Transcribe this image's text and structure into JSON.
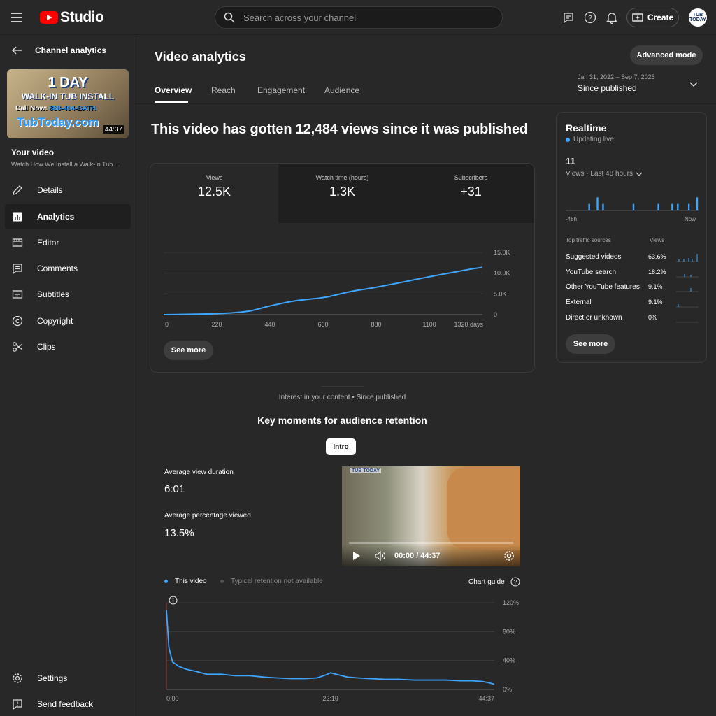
{
  "header": {
    "logo_text": "Studio",
    "search_placeholder": "Search across your channel",
    "create_label": "Create",
    "avatar_text": "TUB TODAY"
  },
  "sidebar": {
    "back_label": "Channel analytics",
    "thumbnail": {
      "line1": "1 DAY",
      "line2": "WALK-IN TUB INSTALL",
      "line3_prefix": "Call Now: ",
      "line3_phone": "888-494-BATH",
      "line4": "TubToday.com",
      "duration": "44:37"
    },
    "your_video_label": "Your video",
    "video_title": "Watch How We Install a Walk-In Tub ...",
    "items": [
      {
        "label": "Details",
        "icon": "pencil-icon"
      },
      {
        "label": "Analytics",
        "icon": "analytics-icon"
      },
      {
        "label": "Editor",
        "icon": "editor-icon"
      },
      {
        "label": "Comments",
        "icon": "comments-icon"
      },
      {
        "label": "Subtitles",
        "icon": "subtitles-icon"
      },
      {
        "label": "Copyright",
        "icon": "copyright-icon"
      },
      {
        "label": "Clips",
        "icon": "scissors-icon"
      }
    ],
    "active_item": "Analytics",
    "settings_label": "Settings",
    "feedback_label": "Send feedback"
  },
  "main": {
    "title": "Video analytics",
    "advanced_mode_label": "Advanced mode",
    "tabs": [
      "Overview",
      "Reach",
      "Engagement",
      "Audience"
    ],
    "active_tab": "Overview",
    "date_range": "Jan 31, 2022 – Sep 7, 2025",
    "date_label": "Since published",
    "headline": "This video has gotten 12,484 views since it was published",
    "metrics": [
      {
        "label": "Views",
        "value": "12.5K"
      },
      {
        "label": "Watch time (hours)",
        "value": "1.3K"
      },
      {
        "label": "Subscribers",
        "value": "+31"
      }
    ],
    "see_more_label": "See more",
    "interest_label": "Interest in your content • Since published",
    "key_moments_title": "Key moments for audience retention",
    "intro_chip": "Intro",
    "avg_view_duration_label": "Average view duration",
    "avg_view_duration_value": "6:01",
    "avg_pct_viewed_label": "Average percentage viewed",
    "avg_pct_viewed_value": "13.5%",
    "player_time": "00:00 / 44:37",
    "player_watermark": "TUB TODAY",
    "legend_this": "This video",
    "legend_typical": "Typical retention not available",
    "chart_guide_label": "Chart guide"
  },
  "realtime": {
    "title": "Realtime",
    "status": "Updating live",
    "count": "11",
    "views_label": "Views · Last 48 hours",
    "left_label": "-48h",
    "right_label": "Now",
    "sources_header": "Top traffic sources",
    "views_header": "Views",
    "sources": [
      {
        "name": "Suggested videos",
        "pct": "63.6%"
      },
      {
        "name": "YouTube search",
        "pct": "18.2%"
      },
      {
        "name": "Other YouTube features",
        "pct": "9.1%"
      },
      {
        "name": "External",
        "pct": "9.1%"
      },
      {
        "name": "Direct or unknown",
        "pct": "0%"
      }
    ],
    "see_more_label": "See more"
  },
  "colors": {
    "accent": "#3ea6ff",
    "brand_red": "#ff0000",
    "background": "#282828"
  },
  "chart_data": [
    {
      "type": "line",
      "x_ticks": [
        "0",
        "220",
        "440",
        "660",
        "880",
        "1100",
        "1320 days"
      ],
      "y_ticks": [
        "0",
        "5.0K",
        "10.0K",
        "15.0K"
      ],
      "ylim": [
        0,
        15000
      ],
      "xlim": [
        0,
        1320
      ],
      "grid": true,
      "series": [
        {
          "x": [
            0,
            40,
            80,
            120,
            160,
            200,
            240,
            280,
            320,
            360,
            400,
            440,
            480,
            520,
            560,
            600,
            640,
            680,
            720,
            760,
            800,
            840,
            880,
            920,
            960,
            1000,
            1040,
            1080,
            1120,
            1160,
            1200,
            1240,
            1280,
            1320
          ],
          "y": [
            0,
            30,
            60,
            100,
            140,
            200,
            300,
            430,
            620,
            900,
            1500,
            2100,
            2600,
            3100,
            3450,
            3700,
            3950,
            4300,
            4850,
            5400,
            5850,
            6200,
            6600,
            7050,
            7500,
            7950,
            8450,
            8900,
            9350,
            9800,
            10200,
            10650,
            11050,
            11400
          ]
        }
      ]
    },
    {
      "type": "bar",
      "ylim": [
        0,
        3
      ],
      "bins": 48,
      "values": [
        0,
        0,
        0,
        0,
        0,
        0,
        0,
        0,
        1,
        0,
        0,
        2,
        0,
        1,
        0,
        0,
        0,
        0,
        0,
        0,
        0,
        0,
        0,
        0,
        1,
        0,
        0,
        0,
        0,
        0,
        0,
        0,
        0,
        1,
        0,
        0,
        0,
        0,
        1,
        0,
        1,
        0,
        0,
        0,
        1,
        0,
        0,
        2
      ]
    },
    {
      "type": "line",
      "x_ticks": [
        "0:00",
        "22:19",
        "44:37"
      ],
      "y_ticks": [
        "0%",
        "40%",
        "80%",
        "120%"
      ],
      "ylim": [
        0,
        120
      ],
      "xlim": [
        0,
        2677
      ],
      "grid": true,
      "series": [
        {
          "name": "This video",
          "x": [
            0,
            20,
            50,
            100,
            160,
            240,
            330,
            450,
            560,
            680,
            800,
            900,
            1020,
            1130,
            1230,
            1300,
            1340,
            1410,
            1480,
            1560,
            1660,
            1780,
            1900,
            2020,
            2150,
            2280,
            2400,
            2500,
            2580,
            2640,
            2677
          ],
          "y": [
            110,
            58,
            38,
            32,
            28,
            25,
            21,
            21,
            19,
            19,
            17,
            16,
            15,
            15,
            16,
            20,
            23,
            20,
            17,
            16,
            15,
            14,
            14,
            13,
            13,
            13,
            12,
            12,
            11,
            9,
            7
          ]
        }
      ]
    }
  ]
}
